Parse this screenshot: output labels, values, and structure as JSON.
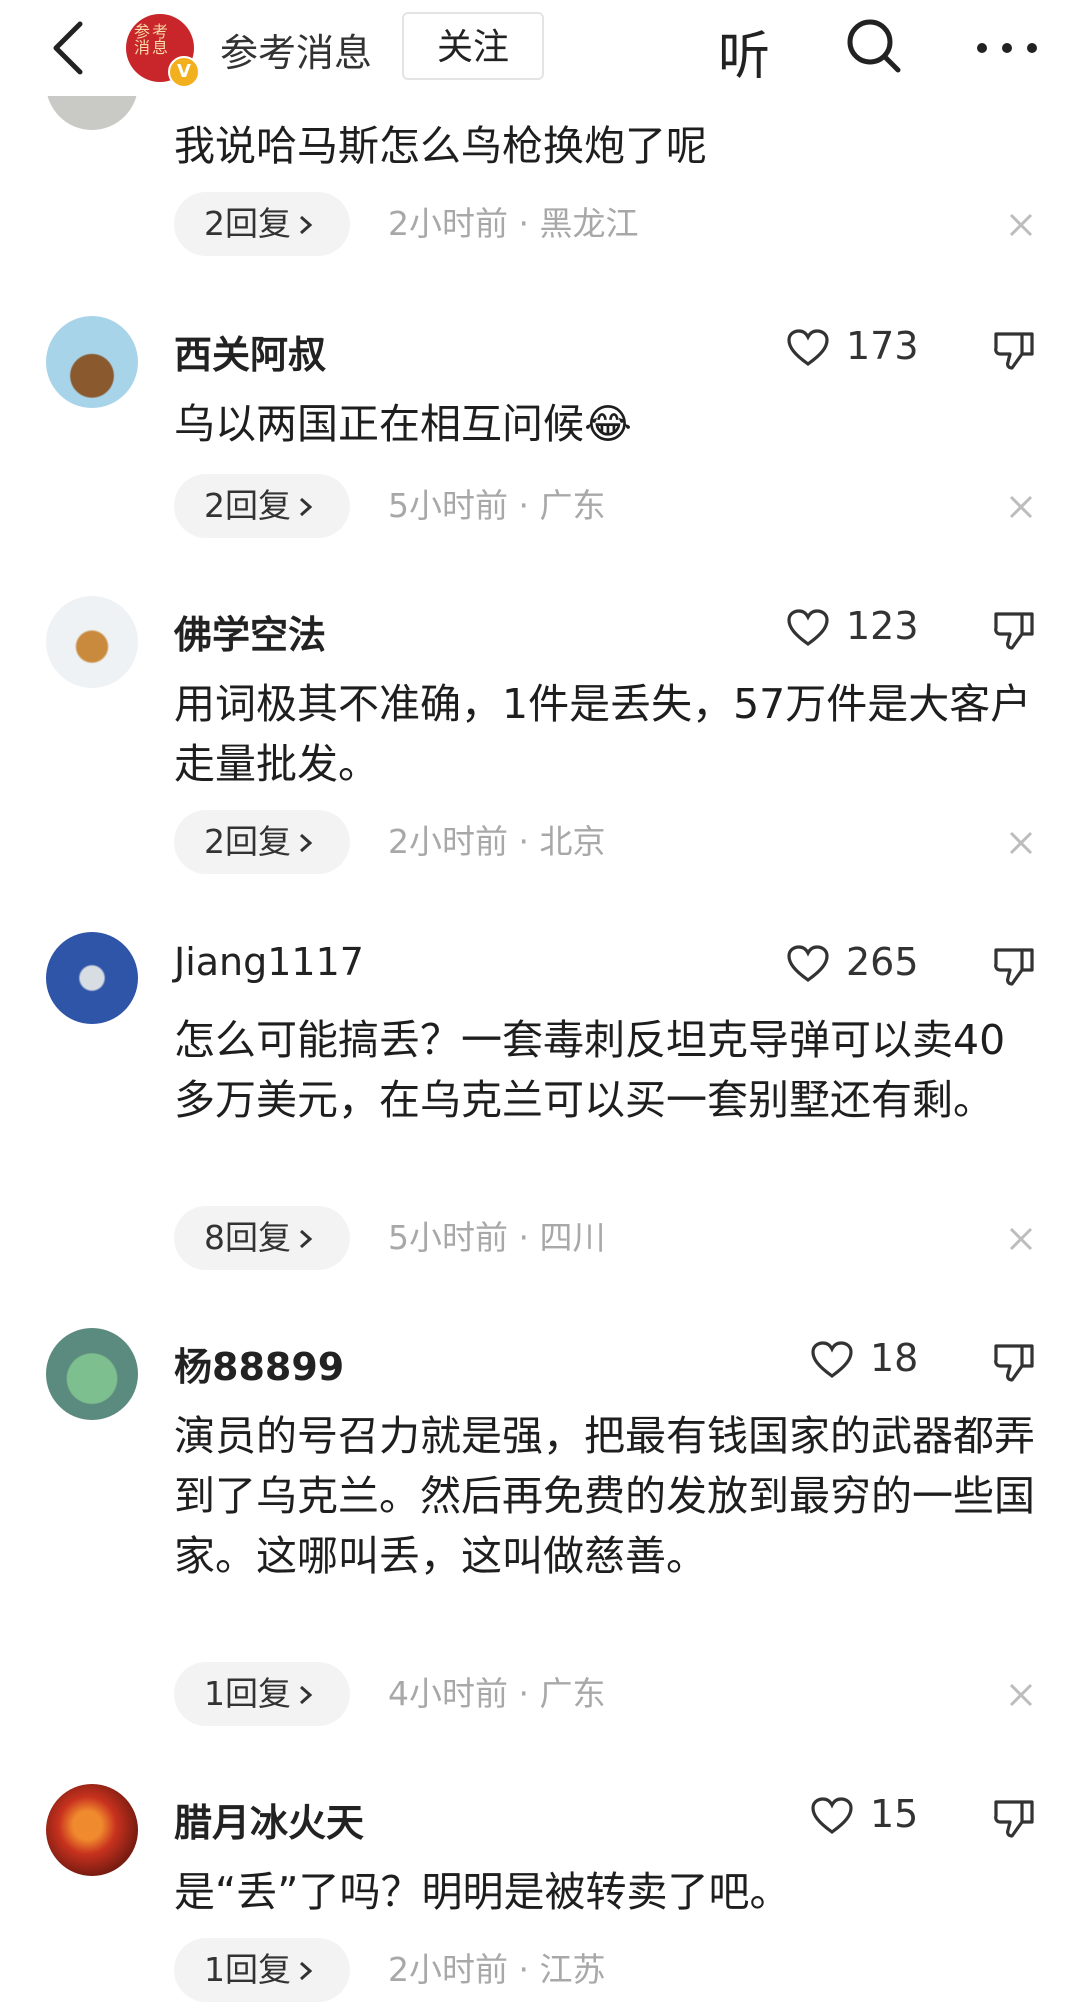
{
  "header": {
    "publisher_name": "参考消息",
    "logo_text": "参考消息",
    "follow_label": "关注",
    "listen_label": "听"
  },
  "comments": [
    {
      "name": "",
      "text": "我说哈马斯怎么鸟枪换炮了呢",
      "likes": "",
      "reply_label": "2回复",
      "time": "2小时前",
      "location": "黑龙江"
    },
    {
      "name": "西关阿叔",
      "text": "乌以两国正在相互问候",
      "emoji": "😂",
      "likes": "173",
      "reply_label": "2回复",
      "time": "5小时前",
      "location": "广东"
    },
    {
      "name": "佛学空法",
      "text": "用词极其不准确，1件是丢失，57万件是大客户走量批发。",
      "likes": "123",
      "reply_label": "2回复",
      "time": "2小时前",
      "location": "北京"
    },
    {
      "name": "Jiang1117",
      "text": "怎么可能搞丢？一套毒刺反坦克导弹可以卖40多万美元，在乌克兰可以买一套别墅还有剩。",
      "likes": "265",
      "reply_label": "8回复",
      "time": "5小时前",
      "location": "四川"
    },
    {
      "name": "杨88899",
      "text": "演员的号召力就是强，把最有钱国家的武器都弄到了乌克兰。然后再免费的发放到最穷的一些国家。这哪叫丢，这叫做慈善。",
      "likes": "18",
      "reply_label": "1回复",
      "time": "4小时前",
      "location": "广东"
    },
    {
      "name": "腊月冰火天",
      "text": "是“丢”了吗？明明是被转卖了吧。",
      "likes": "15",
      "reply_label": "1回复",
      "time": "2小时前",
      "location": "江苏"
    }
  ],
  "meta_separator": "·",
  "colors": {
    "publisher_red": "#c8262a",
    "verified_gold": "#f2b01e",
    "meta_gray": "#a8a8a8",
    "pill_bg": "#f3f3f3"
  },
  "icons": [
    "back-arrow-icon",
    "search-icon",
    "more-dots-icon",
    "heart-icon",
    "thumbs-down-icon",
    "close-icon",
    "chevron-right-icon"
  ]
}
